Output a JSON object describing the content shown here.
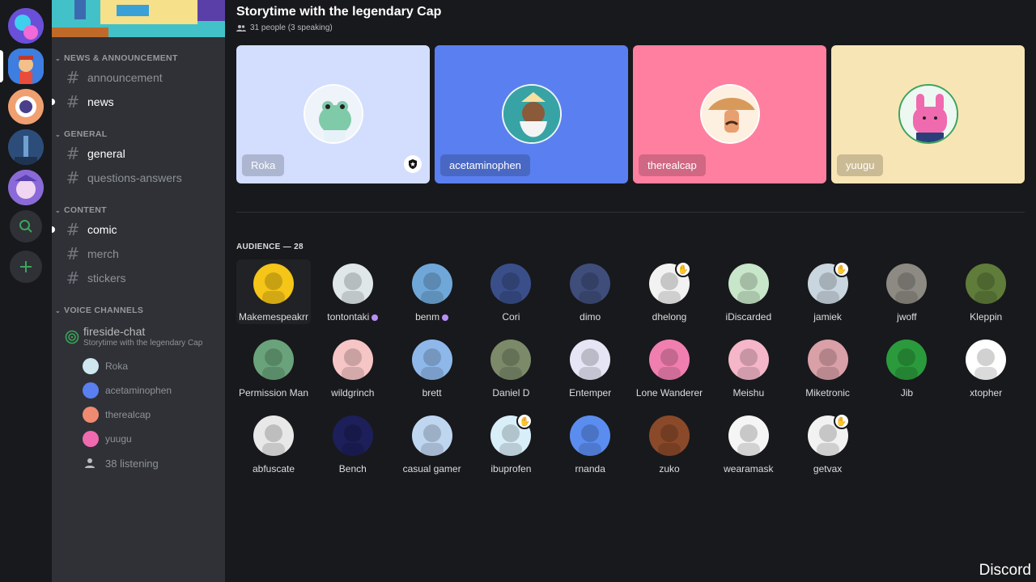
{
  "stage": {
    "title": "Storytime with the legendary Cap",
    "subtitle": "31 people (3 speaking)"
  },
  "speakers": [
    {
      "name": "Roka",
      "bg": "#d3defe",
      "moderator": true
    },
    {
      "name": "acetaminophen",
      "bg": "#5a7ff0",
      "moderator": false
    },
    {
      "name": "therealcap",
      "bg": "#ff7fa0",
      "moderator": false
    },
    {
      "name": "yuugu",
      "bg": "#f8e5b5",
      "moderator": false
    }
  ],
  "audience": {
    "header": "AUDIENCE — 28",
    "members": [
      {
        "name": "Makemespeakrr",
        "color": "#f5c518"
      },
      {
        "name": "tontontaki",
        "color": "#dfe7e8",
        "badge": true
      },
      {
        "name": "benm",
        "color": "#6fa8d8",
        "badge": true
      },
      {
        "name": "Cori",
        "color": "#3a4f8a"
      },
      {
        "name": "dimo",
        "color": "#3f4d7a"
      },
      {
        "name": "dhelong",
        "color": "#f2f2f2",
        "hand": true
      },
      {
        "name": "iDiscarded",
        "color": "#c8e6c9"
      },
      {
        "name": "jamiek",
        "color": "#c9d6df",
        "hand": true
      },
      {
        "name": "jwoff",
        "color": "#8d8a83"
      },
      {
        "name": "Kleppin",
        "color": "#5f7c3a"
      },
      {
        "name": "Permission Man",
        "color": "#6aa37b"
      },
      {
        "name": "wildgrinch",
        "color": "#f6c5c5"
      },
      {
        "name": "brett",
        "color": "#8eb8ea"
      },
      {
        "name": "Daniel D",
        "color": "#7c8a6a"
      },
      {
        "name": "Entemper",
        "color": "#e5e5f5"
      },
      {
        "name": "Lone Wanderer",
        "color": "#f07fb0"
      },
      {
        "name": "Meishu",
        "color": "#f4b6c8"
      },
      {
        "name": "Miketronic",
        "color": "#d9a0a8"
      },
      {
        "name": "Jib",
        "color": "#2b9a3c"
      },
      {
        "name": "xtopher",
        "color": "#ffffff"
      },
      {
        "name": "abfuscate",
        "color": "#e8e8e8"
      },
      {
        "name": "Bench",
        "color": "#1d1f5a"
      },
      {
        "name": "casual gamer",
        "color": "#bfd6f0"
      },
      {
        "name": "ibuprofen",
        "color": "#d8eef8",
        "hand": true
      },
      {
        "name": "rnanda",
        "color": "#5b8df0"
      },
      {
        "name": "zuko",
        "color": "#8a4a2a"
      },
      {
        "name": "wearamask",
        "color": "#f5f5f5"
      },
      {
        "name": "getvax",
        "color": "#f2f2f2",
        "hand": true
      }
    ]
  },
  "sidebar": {
    "categories": [
      {
        "label": "NEWS & ANNOUNCEMENT",
        "channels": [
          {
            "label": "announcement",
            "unread": false
          },
          {
            "label": "news",
            "unread": true
          }
        ]
      },
      {
        "label": "GENERAL",
        "channels": [
          {
            "label": "general",
            "unread": false,
            "bright": true
          },
          {
            "label": "questions-answers",
            "unread": false
          }
        ]
      },
      {
        "label": "CONTENT",
        "channels": [
          {
            "label": "comic",
            "unread": true
          },
          {
            "label": "merch",
            "unread": false
          },
          {
            "label": "stickers",
            "unread": false
          }
        ]
      }
    ],
    "voice_category": "VOICE CHANNELS",
    "voice_channel": {
      "label": "fireside-chat",
      "topic": "Storytime with the legendary Cap",
      "users": [
        "Roka",
        "acetaminophen",
        "therealcap",
        "yuugu"
      ],
      "listening": "38 listening"
    }
  },
  "servers": [
    {
      "color": "#7c6cf0",
      "active": false
    },
    {
      "color": "#4f8de8",
      "active": true
    },
    {
      "color": "#e88a5a",
      "active": false
    },
    {
      "color": "#3f6aa0",
      "active": false
    },
    {
      "color": "#9a7ae0",
      "active": false
    }
  ],
  "icons": {
    "search": "search-icon",
    "add": "plus-icon"
  },
  "watermark": "Discord"
}
